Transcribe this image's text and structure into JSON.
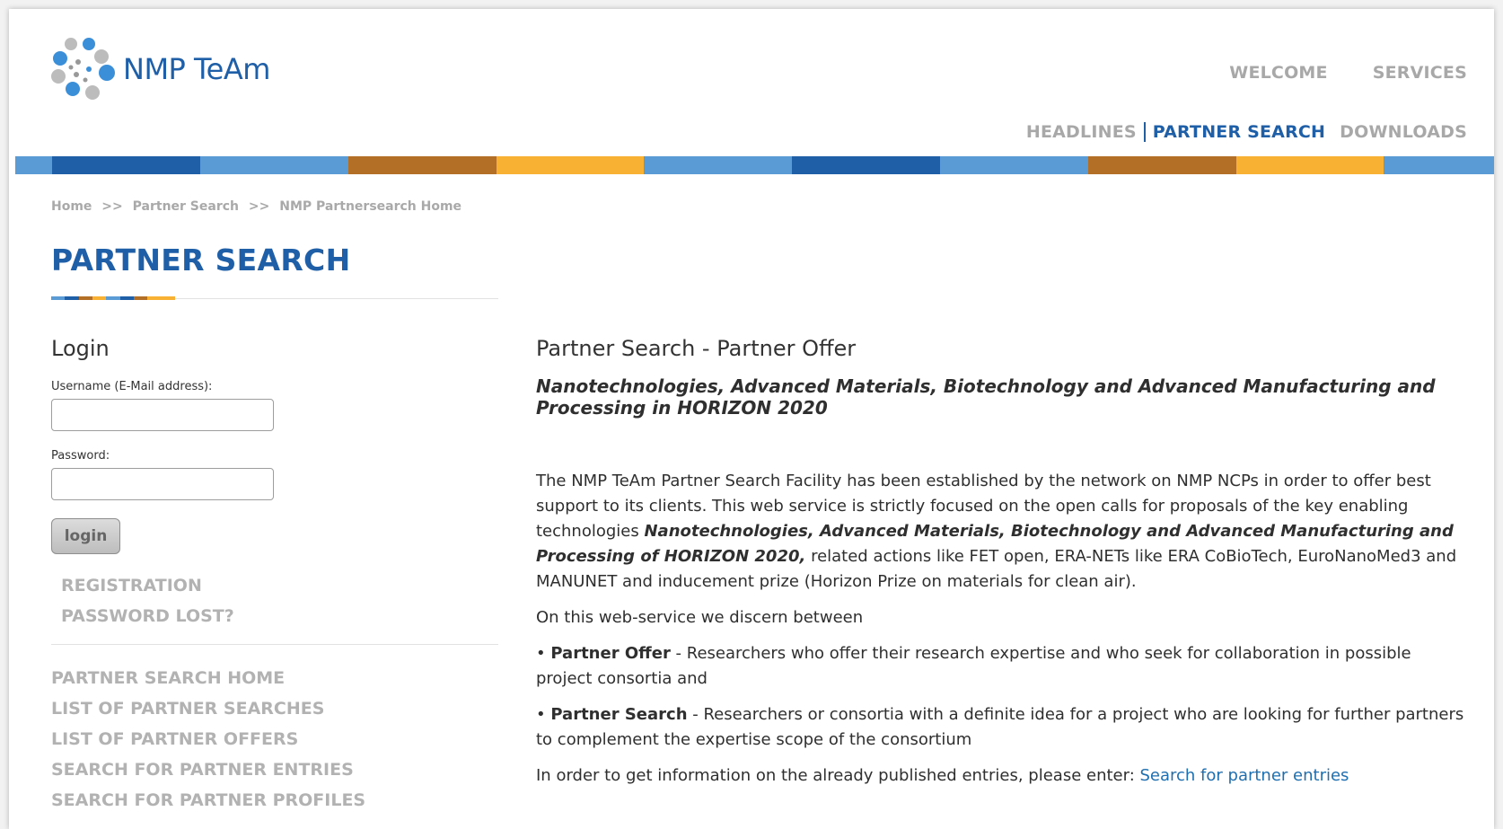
{
  "logo": {
    "text": "NMP TeAm"
  },
  "nav": {
    "top": [
      "WELCOME",
      "SERVICES"
    ],
    "sub": [
      {
        "label": "HEADLINES",
        "active": false
      },
      {
        "label": "PARTNER SEARCH",
        "active": true
      },
      {
        "label": "DOWNLOADS",
        "active": false
      }
    ]
  },
  "colors": {
    "brand_blue": "#1f5fa8",
    "light_blue": "#5b9bd5",
    "brown": "#b26f25",
    "orange": "#f8b133",
    "muted_gray": "#a9a9a9",
    "link_blue": "#1f6fb0"
  },
  "breadcrumb": [
    "Home",
    ">>",
    "Partner Search",
    ">>",
    "NMP Partnersearch Home"
  ],
  "page_title": "PARTNER SEARCH",
  "login": {
    "title": "Login",
    "username_label": "Username (E-Mail address):",
    "username_value": "",
    "password_label": "Password:",
    "password_value": "",
    "button": "login",
    "links": [
      "REGISTRATION",
      "PASSWORD LOST?"
    ]
  },
  "sidebar_links": [
    "PARTNER SEARCH HOME",
    "LIST OF PARTNER SEARCHES",
    "LIST OF PARTNER OFFERS",
    "SEARCH FOR PARTNER ENTRIES",
    "SEARCH FOR PARTNER PROFILES"
  ],
  "main": {
    "heading": "Partner Search - Partner Offer",
    "subtitle": "Nanotechnologies, Advanced Materials, Biotechnology and Advanced Manufacturing and Processing in HORIZON 2020",
    "p1_a": "The NMP TeAm Partner Search Facility has been established by the network on NMP NCPs in order to offer best support to its clients. This web service is strictly focused on the open calls for proposals of the key enabling technologies ",
    "p1_bold": "Nanotechnologies, Advanced Materials, Biotechnology and Advanced Manufacturing and Processing of HORIZON 2020,",
    "p1_b": " related actions like FET open, ERA-NETs like ERA CoBioTech, EuroNanoMed3 and MANUNET and inducement prize (Horizon Prize on materials for clean air).",
    "p2": "On this web-service we discern between",
    "offer_bullet": "• ",
    "offer_term": "Partner Offer",
    "offer_text": " - Researchers who offer their research expertise and who seek for collaboration in possible project consortia and",
    "search_bullet": "• ",
    "search_term": "Partner Search",
    "search_text": " - Researchers or consortia with a definite idea for a project who are looking for further partners to complement the expertise scope of the consortium",
    "p5_text": "In order to get information on the already published entries, please enter: ",
    "p5_link": "Search for partner entries"
  }
}
